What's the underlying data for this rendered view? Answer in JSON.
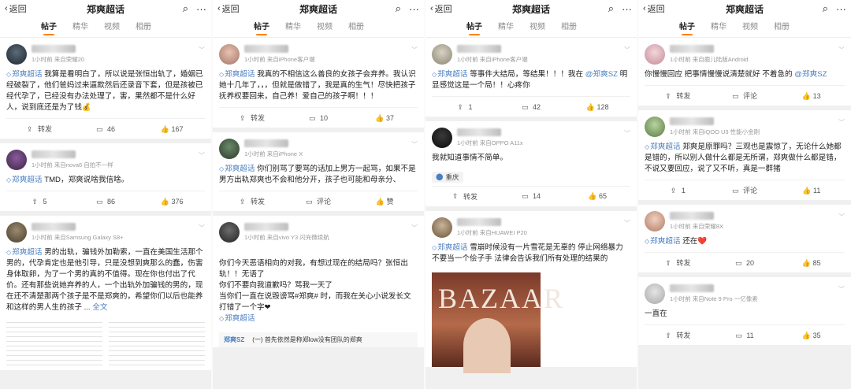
{
  "nav": {
    "back_label": "返回",
    "title": "郑爽超话",
    "tabs": [
      "帖子",
      "精华",
      "视频",
      "相册"
    ],
    "search_icon": "search-icon",
    "more_icon": "more-icon"
  },
  "actions": {
    "repost": "转发",
    "comment": "评论",
    "like": "赞"
  },
  "panels": [
    {
      "posts": [
        {
          "sub": "1小时前  来自荣耀20",
          "tag": "郑爽超话",
          "text": "我算是看明白了，所以说是张恒出轨了，婚姻已经破裂了，他们爸妈过来逼欺然后还录音下套，但是孩被已经代孕了，已经没有办法处理了，害，果然都不是什么好人，说到底还是为了钱💰",
          "repost": "转发",
          "comment": "46",
          "like": "167"
        },
        {
          "sub": "1小时前  来自nova6 自拍不一样",
          "tag": "郑爽超话",
          "text": "TMD，郑爽说啥我信啥。",
          "repost": "5",
          "comment": "86",
          "like": "376"
        },
        {
          "sub": "1小时前  来自Samsung Galaxy S8+",
          "tag": "郑爽超话",
          "text": "男的出轨，骗钱外加勒索，一直在美国生活那个男的，代孕肯定也是他引导，只是没想到爽那么的蠢，伤害身体取卵，为了一个男的真的不值得。现在你也付出了代价。还有那些说她弃养的人，一个出轨外加骗钱的男的，现在还不清楚那两个孩子是不是郑爽的，希望你们以后也能养和这样的男人生的孩子 ...",
          "more": "全文"
        }
      ]
    },
    {
      "posts": [
        {
          "sub": "1小时前  来自iPhone客户端",
          "tag": "郑爽超话",
          "text": "我真的不相信这么善良的女孩子会弃养。我认识她十几年了，，，但就是做错了，我是真的生气！尽快把孩子抚养权要回来，自己养！爱自己的孩子啊！！！",
          "repost": "转发",
          "comment": "10",
          "like": "37"
        },
        {
          "sub": "1小时前  来自iPhone X",
          "tag": "郑爽超话",
          "text": "你们别骂了要骂的话加上男方一起骂，如果不是男方出轨郑爽也不会和他分开，孩子也可能和母亲分、",
          "repost": "转发",
          "comment": "评论",
          "like": "赞"
        },
        {
          "sub": "1小时前  来自vivo Y3 闪充微续航",
          "tag": "郑爽超话",
          "text": "你们今天恶语相向的对我，有想过现在的结局吗？张恒出轨！！无语了\n你们不要向我道歉吗？骂我一天了\n当你们一直在说毁谤骂#郑爽# 时，而我在关心小说发长文打错了一个字❤",
          "quote_user": "郑爽SZ",
          "quote_text": "(一) 首先依然是称郑low没有团队的郑爽"
        }
      ]
    },
    {
      "posts": [
        {
          "sub": "1小时前  来自iPhone客户端",
          "tag": "郑爽超话",
          "text": "等事件大结局，等结果！！！我在",
          "mention": "@郑爽SZ",
          "text2": "明显感觉这是一个局！！心疼你",
          "repost": "1",
          "comment": "42",
          "like": "128"
        },
        {
          "sub": "1小时前  来自OPPO A11x",
          "text": "我就知道事情不简单。",
          "location": "重庆",
          "repost": "转发",
          "comment": "14",
          "like": "65"
        },
        {
          "sub": "1小时前  来自HUAWEI P20",
          "tag": "郑爽超话",
          "text": "雪崩时候没有一片雪花是无辜的 停止网络暴力 不要当一个侩子手 法律会告诉我们所有处理的结果的",
          "image_text": "BAZAAR"
        }
      ]
    },
    {
      "posts": [
        {
          "sub": "1小时前  来自鹿儿陆版Android",
          "text": "你慢慢回应 把事情慢慢说清楚就好 不着急的",
          "mention": "@郑爽SZ",
          "repost": "转发",
          "comment": "评论",
          "like": "13"
        },
        {
          "sub": "1小时前  来自iQOO U3 性能小金刚",
          "tag": "郑爽超话",
          "text": "郑爽是原罪吗？三观也是震惊了，无论什么她都是错的，所以别人做什么都是无所谓，郑爽做什么都是错，不说又要回应，说了又不听，真是一群猪",
          "repost": "1",
          "comment": "评论",
          "like": "11"
        },
        {
          "sub": "1小时前  来自荣耀8X",
          "tag": "郑爽超话",
          "text": "还在❤️",
          "repost": "转发",
          "comment": "20",
          "like": "85"
        },
        {
          "sub": "1小时前  来自Note 9 Pro 一亿像素",
          "text": "一直在",
          "repost": "转发",
          "comment": "11",
          "like": "35"
        }
      ]
    }
  ]
}
